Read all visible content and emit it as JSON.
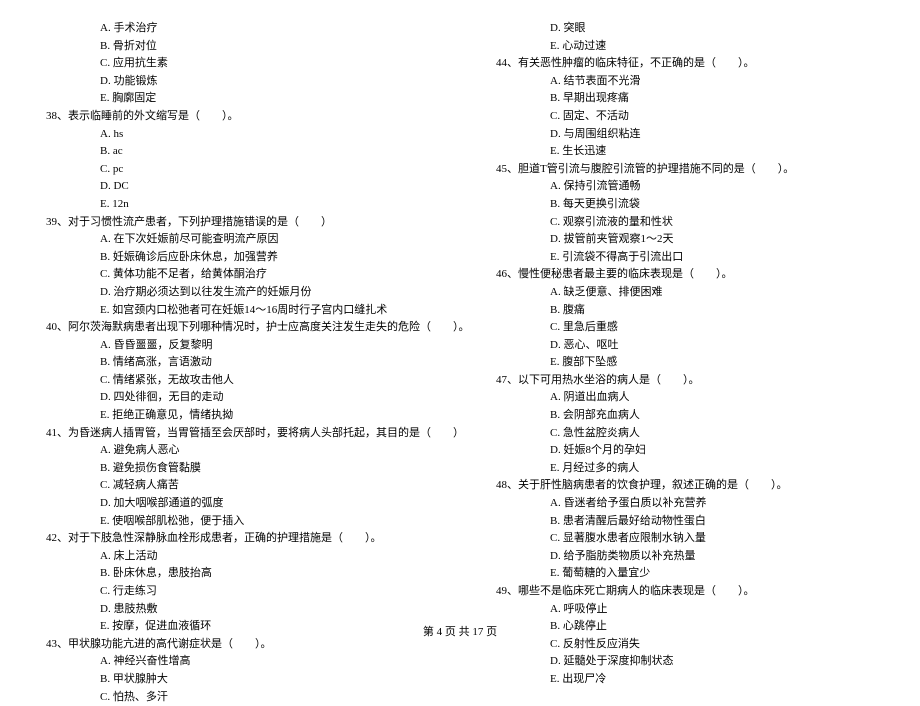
{
  "left": {
    "pre_options": [
      "A. 手术治疗",
      "B. 骨折对位",
      "C. 应用抗生素",
      "D. 功能锻炼",
      "E. 胸廓固定"
    ],
    "items": [
      {
        "num": "38、",
        "stem": "表示临睡前的外文缩写是（　　）。",
        "opts": [
          "A. hs",
          "B. ac",
          "C. pc",
          "D. DC",
          "E. 12n"
        ]
      },
      {
        "num": "39、",
        "stem": "对于习惯性流产患者，下列护理措施错误的是（　　）",
        "opts": [
          "A. 在下次妊娠前尽可能查明流产原因",
          "B. 妊娠确诊后应卧床休息，加强营养",
          "C. 黄体功能不足者，给黄体酮治疗",
          "D. 治疗期必须达到以往发生流产的妊娠月份",
          "E. 如宫颈内口松弛者可在妊娠14～16周时行子宫内口缝扎术"
        ]
      },
      {
        "num": "40、",
        "stem": "阿尔茨海默病患者出现下列哪种情况时，护士应高度关注发生走失的危险（　　）。",
        "opts": [
          "A. 昏昏噩噩，反复黎明",
          "B. 情绪高涨，言语激动",
          "C. 情绪紧张，无故攻击他人",
          "D. 四处徘徊，无目的走动",
          "E. 拒绝正确意见，情绪执拗"
        ]
      },
      {
        "num": "41、",
        "stem": "为昏迷病人插胃管，当胃管插至会厌部时，要将病人头部托起，其目的是（　　）",
        "opts": [
          "A. 避免病人恶心",
          "B. 避免损伤食管黏膜",
          "C. 减轻病人痛苦",
          "D. 加大咽喉部通道的弧度",
          "E. 使咽喉部肌松弛，便于插入"
        ]
      },
      {
        "num": "42、",
        "stem": "对于下肢急性深静脉血栓形成患者，正确的护理措施是（　　）。",
        "opts": [
          "A. 床上活动",
          "B. 卧床休息，患肢抬高",
          "C. 行走练习",
          "D. 患肢热敷",
          "E. 按摩，促进血液循环"
        ]
      },
      {
        "num": "43、",
        "stem": "甲状腺功能亢进的高代谢症状是（　　）。",
        "opts": [
          "A. 神经兴奋性增高",
          "B. 甲状腺肿大",
          "C. 怕热、多汗"
        ]
      }
    ]
  },
  "right": {
    "pre_options": [
      "D. 突眼",
      "E. 心动过速"
    ],
    "items": [
      {
        "num": "44、",
        "stem": "有关恶性肿瘤的临床特征，不正确的是（　　）。",
        "opts": [
          "A. 结节表面不光滑",
          "B. 早期出现疼痛",
          "C. 固定、不活动",
          "D. 与周围组织粘连",
          "E. 生长迅速"
        ]
      },
      {
        "num": "45、",
        "stem": "胆道T管引流与腹腔引流管的护理措施不同的是（　　）。",
        "opts": [
          "A. 保持引流管通畅",
          "B. 每天更换引流袋",
          "C. 观察引流液的量和性状",
          "D. 拔管前夹管观察1～2天",
          "E. 引流袋不得高于引流出口"
        ]
      },
      {
        "num": "46、",
        "stem": "慢性便秘患者最主要的临床表现是（　　）。",
        "opts": [
          "A. 缺乏便意、排便困难",
          "B. 腹痛",
          "C. 里急后重感",
          "D. 恶心、呕吐",
          "E. 腹部下坠感"
        ]
      },
      {
        "num": "47、",
        "stem": "以下可用热水坐浴的病人是（　　）。",
        "opts": [
          "A. 阴道出血病人",
          "B. 会阴部充血病人",
          "C. 急性盆腔炎病人",
          "D. 妊娠8个月的孕妇",
          "E. 月经过多的病人"
        ]
      },
      {
        "num": "48、",
        "stem": "关于肝性脑病患者的饮食护理，叙述正确的是（　　）。",
        "opts": [
          "A. 昏迷者给予蛋白质以补充营养",
          "B. 患者清醒后最好给动物性蛋白",
          "C. 显著腹水患者应限制水钠入量",
          "D. 给予脂肪类物质以补充热量",
          "E. 葡萄糖的入量宜少"
        ]
      },
      {
        "num": "49、",
        "stem": "哪些不是临床死亡期病人的临床表现是（　　）。",
        "opts": [
          "A. 呼吸停止",
          "B. 心跳停止",
          "C. 反射性反应消失",
          "D. 延髓处于深度抑制状态",
          "E. 出现尸冷"
        ]
      }
    ]
  },
  "footer": "第 4 页 共 17 页"
}
